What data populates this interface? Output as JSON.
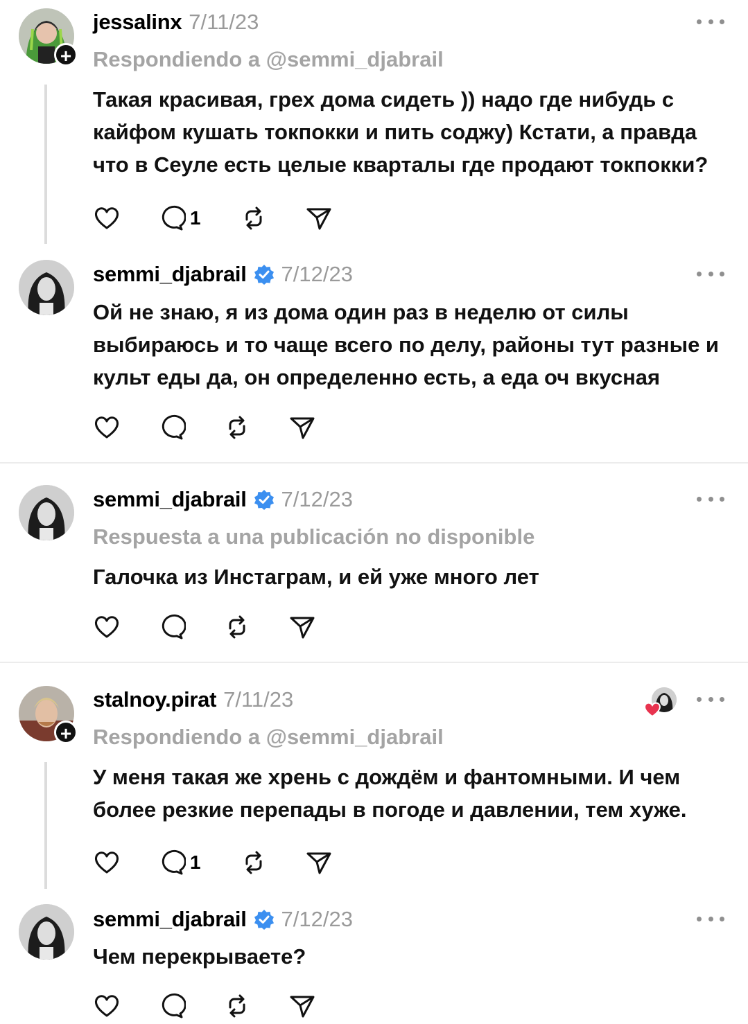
{
  "posts": [
    {
      "username": "jessalinx",
      "date": "7/11/23",
      "reply_to": "Respondiendo a @semmi_djabrail",
      "text": "Такая красивая, грех дома сидеть )) надо где нибудь с кайфом кушать токпокки и пить соджу) Кстати, а правда что в Сеуле есть целые кварталы где продают токпокки?",
      "reply_count": "1"
    },
    {
      "username": "semmi_djabrail",
      "date": "7/12/23",
      "text": "Ой не знаю, я из дома один раз в неделю от силы выбираюсь и то чаще всего по делу, районы тут разные и культ еды да, он определенно есть, а еда оч вкусная"
    },
    {
      "username": "semmi_djabrail",
      "date": "7/12/23",
      "reply_to": "Respuesta a una publicación no disponible",
      "text": "Галочка из Инстаграм, и ей уже много лет"
    },
    {
      "username": "stalnoy.pirat",
      "date": "7/11/23",
      "reply_to": "Respondiendo a @semmi_djabrail",
      "text": "У меня такая же хрень с дождём и фантомными. И чем более резкие перепады в погоде и давлении, тем хуже.",
      "reply_count": "1"
    },
    {
      "username": "semmi_djabrail",
      "date": "7/12/23",
      "text": "Чем перекрываете?"
    }
  ],
  "icons": {
    "plus": "+",
    "like": "heart-icon",
    "reply": "comment-icon",
    "repost": "repost-icon",
    "share": "send-icon",
    "more": "more-icon",
    "verified": "verified-badge-icon"
  },
  "colors": {
    "verified": "#3b8ff0",
    "liked": "#e8334f",
    "muted": "#9a9a9a"
  }
}
